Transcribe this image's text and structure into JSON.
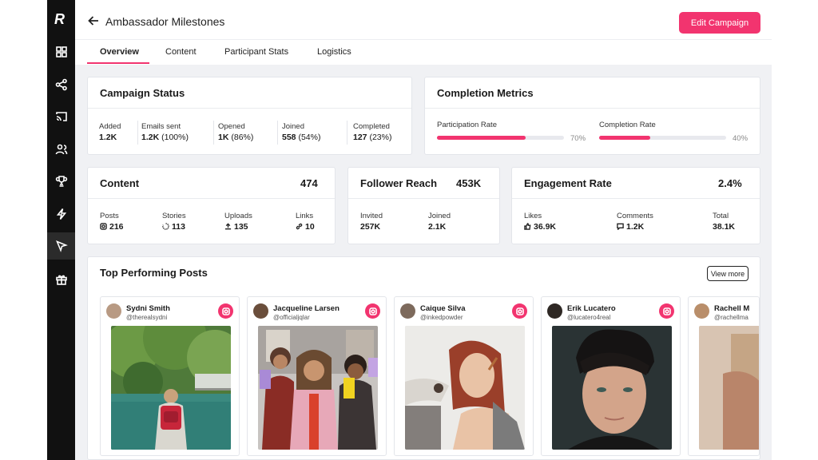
{
  "app": {
    "logo": "R",
    "title": "Ambassador Milestones",
    "edit_label": "Edit Campaign"
  },
  "sidebar": {
    "items": [
      {
        "icon": "grid-icon"
      },
      {
        "icon": "share-nodes-icon"
      },
      {
        "icon": "cast-icon"
      },
      {
        "icon": "users-icon"
      },
      {
        "icon": "trophy-icon"
      },
      {
        "icon": "lightning-icon"
      },
      {
        "icon": "cursor-icon",
        "active": true
      },
      {
        "icon": "gift-icon"
      }
    ]
  },
  "tabs": [
    "Overview",
    "Content",
    "Participant Stats",
    "Logistics"
  ],
  "campaign_status": {
    "title": "Campaign Status",
    "stats": [
      {
        "label": "Added",
        "value": "1.2K",
        "sub": ""
      },
      {
        "label": "Emails sent",
        "value": "1.2K",
        "sub": "(100%)"
      },
      {
        "label": "Opened",
        "value": "1K",
        "sub": "(86%)"
      },
      {
        "label": "Joined",
        "value": "558",
        "sub": "(54%)"
      },
      {
        "label": "Completed",
        "value": "127",
        "sub": "(23%)"
      }
    ]
  },
  "completion": {
    "title": "Completion Metrics",
    "metrics": [
      {
        "label": "Participation Rate",
        "pct_text": "70%",
        "fill": 0.7
      },
      {
        "label": "Completion Rate",
        "pct_text": "40%",
        "fill": 0.4
      }
    ]
  },
  "content": {
    "title": "Content",
    "total": "474",
    "stats": [
      {
        "label": "Posts",
        "value": "216",
        "icon": "instagram-icon"
      },
      {
        "label": "Stories",
        "value": "113",
        "icon": "story-icon"
      },
      {
        "label": "Uploads",
        "value": "135",
        "icon": "upload-icon"
      },
      {
        "label": "Links",
        "value": "10",
        "icon": "link-icon"
      }
    ]
  },
  "reach": {
    "title": "Follower Reach",
    "total": "453K",
    "stats": [
      {
        "label": "Invited",
        "value": "257K"
      },
      {
        "label": "Joined",
        "value": "2.1K"
      }
    ]
  },
  "engagement": {
    "title": "Engagement Rate",
    "total": "2.4%",
    "stats": [
      {
        "label": "Likes",
        "value": "36.9K",
        "icon": "thumbs-up-icon"
      },
      {
        "label": "Comments",
        "value": "1.2K",
        "icon": "comment-icon"
      },
      {
        "label": "Total",
        "value": "38.1K",
        "icon": ""
      }
    ]
  },
  "top_posts": {
    "title": "Top Performing Posts",
    "view_more": "View more",
    "posts": [
      {
        "name": "Sydni Smith",
        "handle": "@therealsydni",
        "scene": "lake-hiker"
      },
      {
        "name": "Jacqueline Larsen",
        "handle": "@officialjqlar",
        "scene": "three-women"
      },
      {
        "name": "Caique Silva",
        "handle": "@inkedpowder",
        "scene": "makeup"
      },
      {
        "name": "Erik Lucatero",
        "handle": "@lucatero4real",
        "scene": "portrait"
      },
      {
        "name": "Rachell M",
        "handle": "@rachellma",
        "scene": "blur"
      }
    ]
  },
  "colors": {
    "accent": "#f2346f",
    "sidebar": "#111111",
    "background": "#f0f1f4"
  }
}
